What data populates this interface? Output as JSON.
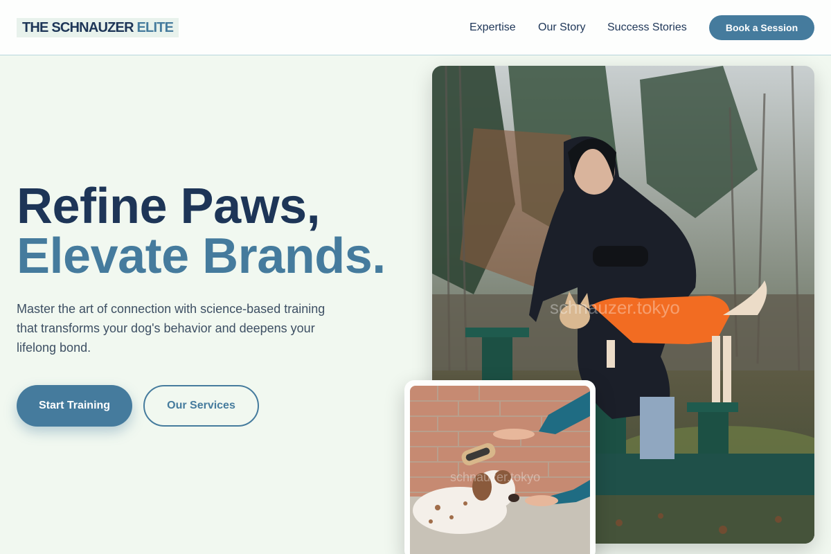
{
  "header": {
    "logo_main": "THE SCHNAUZER",
    "logo_accent": "ELITE",
    "nav": {
      "expertise": "Expertise",
      "story": "Our Story",
      "success": "Success Stories"
    },
    "cta": "Book a Session"
  },
  "hero": {
    "title_line1": "Refine Paws,",
    "title_line2": "Elevate Brands.",
    "subtitle": "Master the art of connection with science-based training that transforms your dog's behavior and deepens your lifelong bond.",
    "primary_button": "Start Training",
    "secondary_button": "Our Services"
  },
  "images": {
    "main_watermark": "schnauzer.tokyo",
    "inset_watermark": "schnauzer.tokyo"
  },
  "colors": {
    "navy": "#1d3557",
    "accent": "#457b9d",
    "background": "#f1f8f0"
  }
}
